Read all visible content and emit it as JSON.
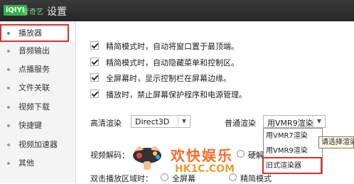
{
  "window": {
    "logo_text": "iQIYI",
    "brand_text": "爱奇艺",
    "title": "设置"
  },
  "sidebar": {
    "items": [
      {
        "label": "播放器"
      },
      {
        "label": "音频输出"
      },
      {
        "label": "点播服务"
      },
      {
        "label": "文件关联"
      },
      {
        "label": "视频下载"
      },
      {
        "label": "快捷键"
      },
      {
        "label": "视频加速器"
      },
      {
        "label": "其他"
      }
    ]
  },
  "options": [
    {
      "label": "精简模式时，自动将窗口置于最顶端。",
      "checked": true
    },
    {
      "label": "精简模式时，自动隐藏菜单和控制区。",
      "checked": true
    },
    {
      "label": "全屏幕时，显示控制栏在屏幕边缘。",
      "checked": true
    },
    {
      "label": "播放时，禁止屏幕保护程序和电源管理。",
      "checked": true
    }
  ],
  "render": {
    "hd_label": "高清渲染",
    "hd_value": "Direct3D",
    "normal_label": "普通渲染",
    "normal_value": "用VMR9渲染",
    "options": [
      "用VMR7渲染",
      "用VMR9渲染",
      "旧式渲染器"
    ],
    "tooltip": "请选择渲染"
  },
  "decode": {
    "label": "视频解码：",
    "hard_label": "硬解"
  },
  "dblclick": {
    "label": "双击播放区域时：",
    "fullscreen_label": "全屏幕",
    "compact_label": "精简模式"
  },
  "watermark": {
    "text1": "欢快娱乐",
    "text2": "HK1C.COM"
  }
}
